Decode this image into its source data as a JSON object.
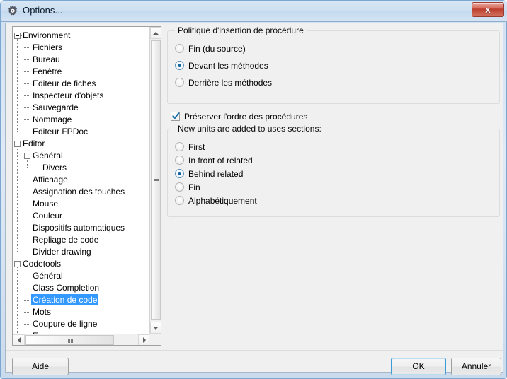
{
  "window": {
    "title": "Options...",
    "icon": "gear-icon",
    "close_label": "x"
  },
  "tree": {
    "nodes": [
      {
        "label": "Environment",
        "level": 0,
        "expander": "collapse",
        "selected": false
      },
      {
        "label": "Fichiers",
        "level": 1,
        "expander": "none",
        "selected": false
      },
      {
        "label": "Bureau",
        "level": 1,
        "expander": "none",
        "selected": false
      },
      {
        "label": "Fenêtre",
        "level": 1,
        "expander": "none",
        "selected": false
      },
      {
        "label": "Editeur de fiches",
        "level": 1,
        "expander": "none",
        "selected": false
      },
      {
        "label": "Inspecteur d'objets",
        "level": 1,
        "expander": "none",
        "selected": false
      },
      {
        "label": "Sauvegarde",
        "level": 1,
        "expander": "none",
        "selected": false
      },
      {
        "label": "Nommage",
        "level": 1,
        "expander": "none",
        "selected": false
      },
      {
        "label": "Editeur FPDoc",
        "level": 1,
        "expander": "none",
        "selected": false
      },
      {
        "label": "Editor",
        "level": 0,
        "expander": "collapse",
        "selected": false
      },
      {
        "label": "Général",
        "level": 1,
        "expander": "collapse",
        "selected": false
      },
      {
        "label": "Divers",
        "level": 2,
        "expander": "none",
        "selected": false
      },
      {
        "label": "Affichage",
        "level": 1,
        "expander": "none",
        "selected": false
      },
      {
        "label": "Assignation des touches",
        "level": 1,
        "expander": "none",
        "selected": false
      },
      {
        "label": "Mouse",
        "level": 1,
        "expander": "none",
        "selected": false
      },
      {
        "label": "Couleur",
        "level": 1,
        "expander": "none",
        "selected": false
      },
      {
        "label": "Dispositifs automatiques",
        "level": 1,
        "expander": "none",
        "selected": false
      },
      {
        "label": "Repliage de code",
        "level": 1,
        "expander": "none",
        "selected": false
      },
      {
        "label": "Divider drawing",
        "level": 1,
        "expander": "none",
        "selected": false
      },
      {
        "label": "Codetools",
        "level": 0,
        "expander": "collapse",
        "selected": false
      },
      {
        "label": "Général",
        "level": 1,
        "expander": "none",
        "selected": false
      },
      {
        "label": "Class Completion",
        "level": 1,
        "expander": "none",
        "selected": false
      },
      {
        "label": "Création de code",
        "level": 1,
        "expander": "none",
        "selected": true
      },
      {
        "label": "Mots",
        "level": 1,
        "expander": "none",
        "selected": false
      },
      {
        "label": "Coupure de ligne",
        "level": 1,
        "expander": "none",
        "selected": false
      },
      {
        "label": "Espace",
        "level": 1,
        "expander": "none",
        "selected": false
      }
    ],
    "selected_label": "Création de code"
  },
  "settings": {
    "insertion_policy": {
      "caption": "Politique d'insertion de procédure",
      "options": [
        {
          "label": "Fin (du source)",
          "selected": false
        },
        {
          "label": "Devant les méthodes",
          "selected": true
        },
        {
          "label": "Derrière les méthodes",
          "selected": false
        }
      ]
    },
    "preserve_order": {
      "label": "Préserver l'ordre des procédures",
      "checked": true
    },
    "uses_sections": {
      "caption": "New units are added to uses sections:",
      "options": [
        {
          "label": "First",
          "selected": false
        },
        {
          "label": "In front of related",
          "selected": false
        },
        {
          "label": "Behind related",
          "selected": true
        },
        {
          "label": "Fin",
          "selected": false
        },
        {
          "label": "Alphabétiquement",
          "selected": false
        }
      ]
    }
  },
  "buttons": {
    "help": "Aide",
    "ok": "OK",
    "cancel": "Annuler"
  },
  "colors": {
    "selection": "#3399ff",
    "radio_dot": "#14659e",
    "default_button_border": "#3c9bd6",
    "close_button": "#bc3d2c"
  }
}
